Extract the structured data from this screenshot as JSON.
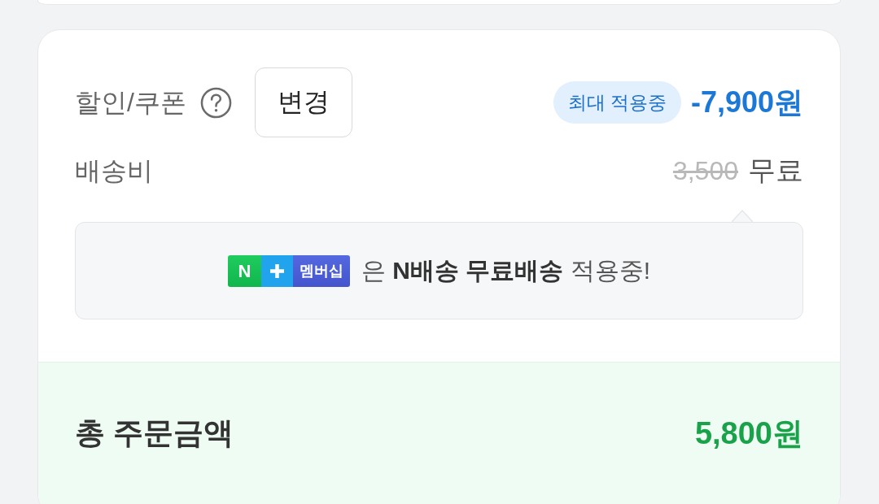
{
  "summary": {
    "rows": [
      {
        "kind": "discount",
        "label": "할인/쿠폰",
        "button": "변경",
        "badge": "최대 적용중",
        "amount": "-7,900원"
      },
      {
        "kind": "shipping",
        "label": "배송비",
        "original": "3,500",
        "amount": "무료"
      }
    ],
    "notice": {
      "logo": {
        "letter": "N",
        "text": "멤버십"
      },
      "message": "은 **N배송 무료배송** 적용중!"
    },
    "total": {
      "label": "총 주문금액",
      "amount": "5,800원"
    }
  }
}
